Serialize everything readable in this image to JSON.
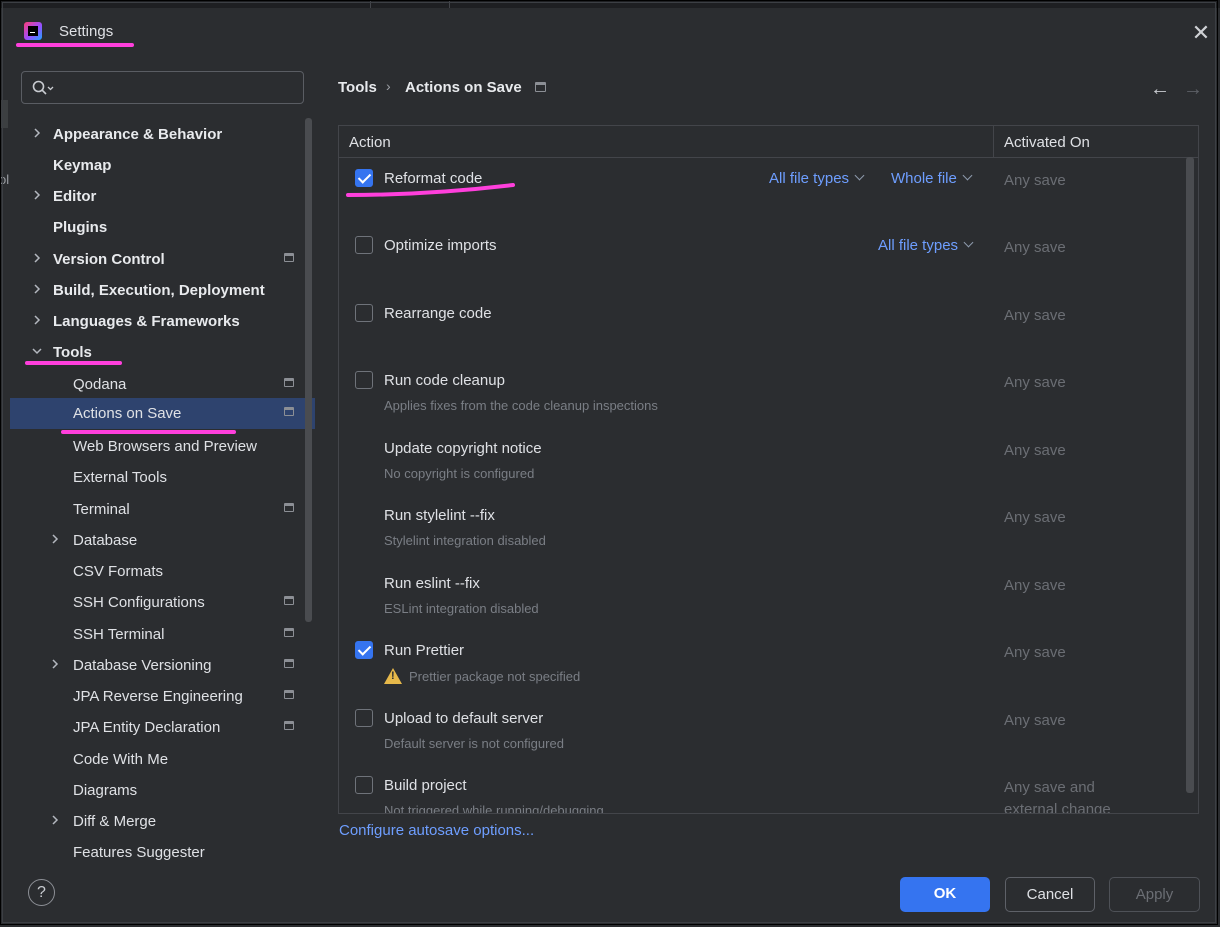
{
  "window": {
    "title": "Settings",
    "backdrop_label": "ol"
  },
  "search": {
    "placeholder": ""
  },
  "sidebar": {
    "items": [
      {
        "label": "Appearance & Behavior"
      },
      {
        "label": "Keymap"
      },
      {
        "label": "Editor"
      },
      {
        "label": "Plugins"
      },
      {
        "label": "Version Control"
      },
      {
        "label": "Build, Execution, Deployment"
      },
      {
        "label": "Languages & Frameworks"
      },
      {
        "label": "Tools"
      },
      {
        "label": "Qodana"
      },
      {
        "label": "Actions on Save"
      },
      {
        "label": "Web Browsers and Preview"
      },
      {
        "label": "External Tools"
      },
      {
        "label": "Terminal"
      },
      {
        "label": "Database"
      },
      {
        "label": "CSV Formats"
      },
      {
        "label": "SSH Configurations"
      },
      {
        "label": "SSH Terminal"
      },
      {
        "label": "Database Versioning"
      },
      {
        "label": "JPA Reverse Engineering"
      },
      {
        "label": "JPA Entity Declaration"
      },
      {
        "label": "Code With Me"
      },
      {
        "label": "Diagrams"
      },
      {
        "label": "Diff & Merge"
      },
      {
        "label": "Features Suggester"
      }
    ]
  },
  "breadcrumb": {
    "parent": "Tools",
    "separator": "›",
    "current": "Actions on Save"
  },
  "nav": {
    "back": "←",
    "forward": "→"
  },
  "table": {
    "headers": {
      "action": "Action",
      "activated_on": "Activated On"
    },
    "rows": [
      {
        "title": "Reformat code",
        "checked": true,
        "dropdowns": [
          "All file types",
          "Whole file"
        ],
        "activated": "Any save"
      },
      {
        "title": "Optimize imports",
        "checked": false,
        "dropdowns": [
          "All file types"
        ],
        "activated": "Any save"
      },
      {
        "title": "Rearrange code",
        "checked": false,
        "activated": "Any save"
      },
      {
        "title": "Run code cleanup",
        "checked": false,
        "subtitle": "Applies fixes from the code cleanup inspections",
        "activated": "Any save"
      },
      {
        "title": "Update copyright notice",
        "subtitle": "No copyright is configured",
        "activated": "Any save"
      },
      {
        "title": "Run stylelint --fix",
        "subtitle": "Stylelint integration disabled",
        "activated": "Any save"
      },
      {
        "title": "Run eslint --fix",
        "subtitle": "ESLint integration disabled",
        "activated": "Any save"
      },
      {
        "title": "Run Prettier",
        "checked": true,
        "subtitle": "Prettier package not specified",
        "warning": true,
        "activated": "Any save"
      },
      {
        "title": "Upload to default server",
        "checked": false,
        "subtitle": "Default server is not configured",
        "activated": "Any save"
      },
      {
        "title": "Build project",
        "checked": false,
        "subtitle": "Not triggered while running/debugging",
        "activated_line1": "Any save and",
        "activated_line2": "external change"
      }
    ]
  },
  "links": {
    "autosave": "Configure autosave options..."
  },
  "footer": {
    "help": "?",
    "ok": "OK",
    "cancel": "Cancel",
    "apply": "Apply"
  },
  "colors": {
    "accent": "#3574f0",
    "link": "#6e9eff",
    "annotation": "#ff3fdc",
    "selection": "#2e436e"
  }
}
